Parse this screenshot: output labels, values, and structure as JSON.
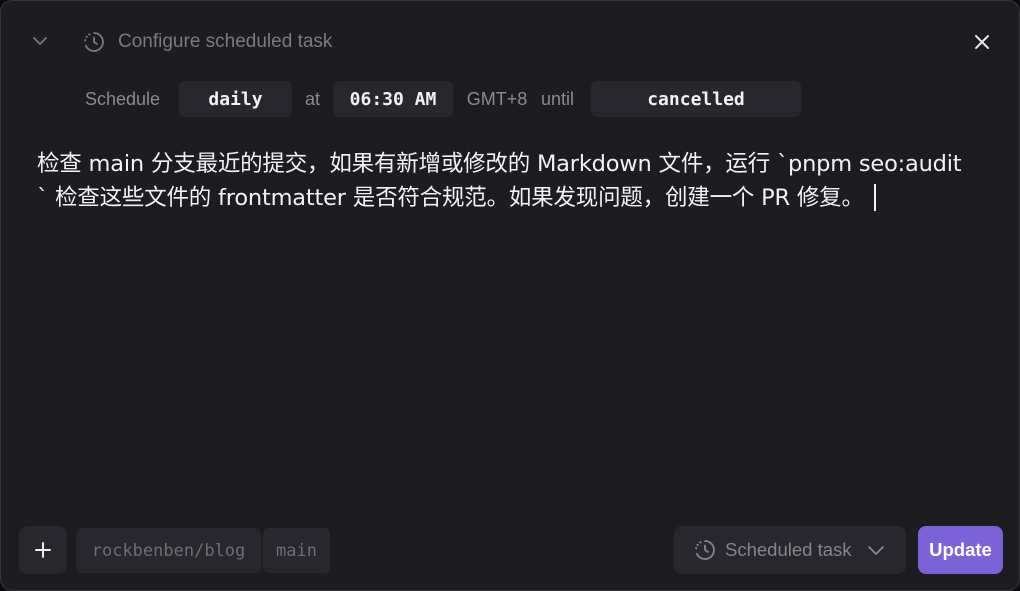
{
  "header": {
    "title": "Configure scheduled task",
    "collapse_icon": "chevron-down-icon",
    "title_icon": "scheduled-clock-icon",
    "close_icon": "close-icon"
  },
  "schedule": {
    "label": "Schedule",
    "frequency": "daily",
    "at_label": "at",
    "time": "06:30 AM",
    "timezone": "GMT+8",
    "until_label": "until",
    "until_value": "cancelled"
  },
  "prompt": {
    "text": "检查 main 分支最近的提交，如果有新增或修改的 Markdown 文件，运行 `pnpm seo:audit` 检查这些文件的 frontmatter 是否符合规范。如果发现问题，创建一个 PR 修复。"
  },
  "footer": {
    "add_icon": "plus-icon",
    "repo": "rockbenben/blog",
    "branch": "main",
    "mode_icon": "scheduled-clock-icon",
    "mode_label": "Scheduled task",
    "mode_chevron": "chevron-down-icon",
    "update_label": "Update"
  },
  "colors": {
    "background": "#1d1c21",
    "accent": "#7b62d9",
    "pill_background": "#28272d",
    "text": "#f2f2f4",
    "muted_text": "#7b7a81"
  }
}
